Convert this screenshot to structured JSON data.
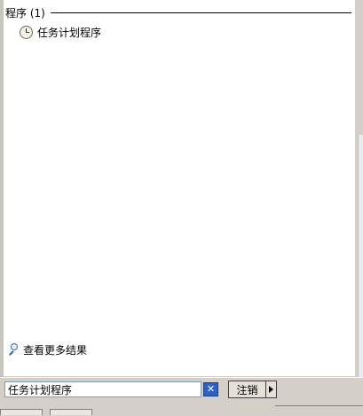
{
  "results": {
    "group_title": "程序 (1)",
    "items": [
      {
        "label": "任务计划程序",
        "icon": "clock-icon"
      }
    ]
  },
  "more_results": {
    "label": "查看更多结果",
    "icon": "magnifier-icon"
  },
  "search": {
    "value": "任务计划程序"
  },
  "actions": {
    "clear_icon": "✕",
    "logoff_label": "注销"
  }
}
